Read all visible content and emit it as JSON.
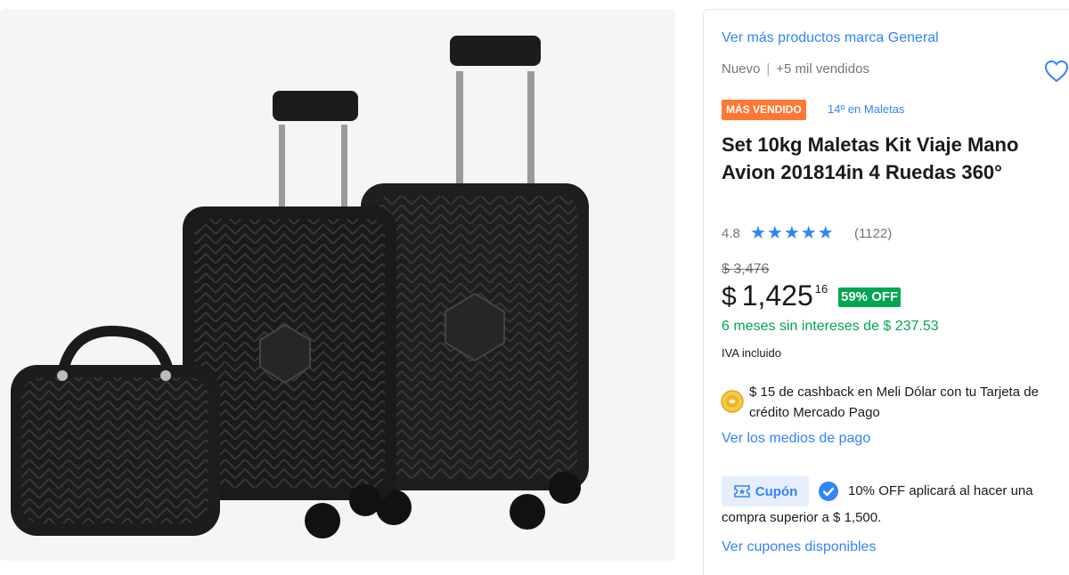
{
  "gallery": {
    "image_alt": "Set de maletas negras"
  },
  "product": {
    "brand_link": "Ver más productos marca General",
    "condition": "Nuevo",
    "sold": "+5 mil vendidos",
    "badge": "MÁS VENDIDO",
    "rank": "14º en Maletas",
    "title": "Set 10kg Maletas Kit Viaje Mano Avion 201814in 4 Ruedas 360°",
    "rating": "4.8",
    "stars": "★★★★★",
    "reviews": "(1122)"
  },
  "price": {
    "original": "$ 3,476",
    "currency": "$",
    "integer": "1,425",
    "cents": "16",
    "discount": "59% OFF",
    "installments": "6 meses sin intereses de $ 237.53",
    "tax_note": "IVA incluido"
  },
  "cashback": {
    "text": "$ 15 de cashback en Meli Dólar con tu Tarjeta de crédito Mercado Pago",
    "payments_link": "Ver los medios de pago"
  },
  "coupon": {
    "tag": "Cupón",
    "text_line1": "10% OFF aplicará al hacer una",
    "text_line2": "compra superior a $ 1,500.",
    "link": "Ver cupones disponibles"
  },
  "colors": {
    "accent": "#3483fa",
    "green": "#00a650",
    "badge_orange": "#ff7733"
  }
}
